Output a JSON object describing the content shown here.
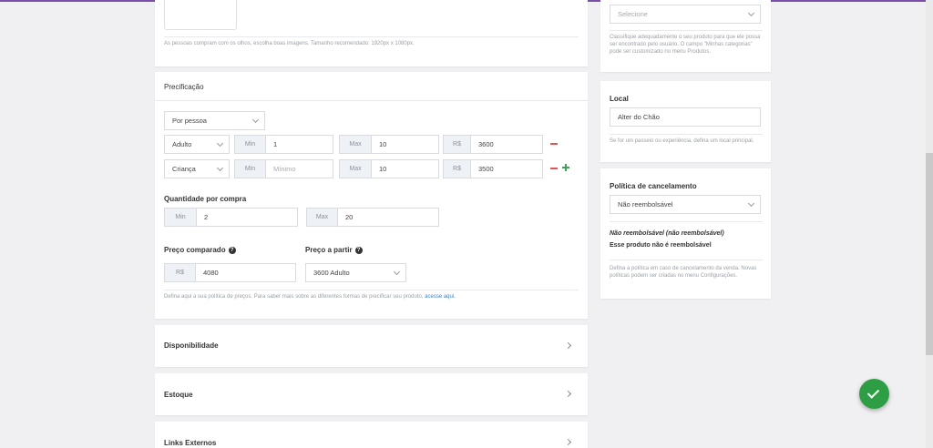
{
  "image_section": {
    "hint": "As pessoas compram com os olhos, escolha boas imagens. Tamanho recomendado: 1920px x 1080px."
  },
  "pricing": {
    "title": "Precificação",
    "mode": "Por pessoa",
    "min_label": "Min",
    "max_label": "Max",
    "currency": "R$",
    "rows": [
      {
        "type": "Adulto",
        "min": "1",
        "min_placeholder": "",
        "max": "10",
        "price": "3600"
      },
      {
        "type": "Criança",
        "min": "",
        "min_placeholder": "Mínimo",
        "max": "10",
        "price": "3500"
      }
    ],
    "quantity_title": "Quantidade por compra",
    "quantity_min": "2",
    "quantity_max": "20",
    "compared_price_label": "Preço comparado",
    "compared_price": "4080",
    "from_price_label": "Preço a partir",
    "from_price": "3600 Adulto",
    "footer_text": "Defina aqui a sua política de preços. Para saber mais sobre as diferentes formas de precificar seu produto, ",
    "footer_link": "acesse aqui."
  },
  "sections": {
    "availability": "Disponibilidade",
    "stock": "Estoque",
    "external_links": "Links Externos"
  },
  "category": {
    "select_placeholder": "Selecione",
    "hint": "Classifique adequadamente o seu produto para que ele possa ser encontrado pelo usuário. O campo \"Minhas categorias\" pode ser customizado no menu Produtos."
  },
  "location": {
    "title": "Local",
    "value": "Alter do Chão",
    "hint": "Se for um passeio ou experiência, defina um local principal."
  },
  "cancellation": {
    "title": "Política de cancelamento",
    "value": "Não reembolsável",
    "policy_name": "Não reembolsável (não reembolsável)",
    "policy_desc": "Esse produto não é reembolsável",
    "hint": "Defina a política em caso de cancelamento da venda. Novas políticas podem ser criadas no menu Configurações."
  },
  "colors": {
    "accent": "#7b4fa8",
    "success": "#2e9e44",
    "remove": "#e05656",
    "add": "#3aa655",
    "link": "#3b82c4"
  }
}
